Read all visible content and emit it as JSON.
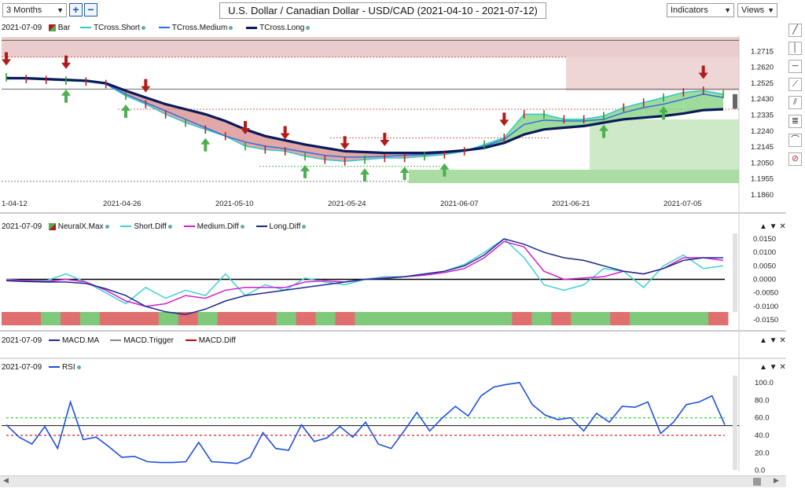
{
  "toolbar": {
    "period": "3 Months",
    "title": "U.S. Dollar / Canadian Dollar - USD/CAD (2021-04-10 - 2021-07-12)",
    "indicators_label": "Indicators",
    "views_label": "Views",
    "zoom_in": "+",
    "zoom_out": "−"
  },
  "colors": {
    "tcross_short": "#2fc8c8",
    "tcross_medium": "#2f6fe0",
    "tcross_long": "#0a1a5a",
    "bull_arrow": "#4caf50",
    "bear_arrow": "#b31b1b",
    "short_diff": "#40d0d0",
    "medium_diff": "#d020d0",
    "long_diff": "#1a2a8a",
    "macd_ma": "#1a2a8a",
    "macd_trigger": "#888888",
    "macd_diff": "#c00000",
    "rsi": "#1e4fe0"
  },
  "panel1_legend": {
    "date": "2021-07-09",
    "bar": "Bar",
    "short": "TCross.Short",
    "medium": "TCross.Medium",
    "long": "TCross.Long"
  },
  "panel2_legend": {
    "date": "2021-07-09",
    "neural": "NeuralX.Max",
    "short": "Short.Diff",
    "medium": "Medium.Diff",
    "long": "Long.Diff"
  },
  "panel3_legend": {
    "date": "2021-07-09",
    "ma": "MACD.MA",
    "trigger": "MACD.Trigger",
    "diff": "MACD.Diff"
  },
  "panel4_legend": {
    "date": "2021-07-09",
    "rsi": "RSI"
  },
  "chart_data": [
    {
      "type": "line",
      "title": "U.S. Dollar / Canadian Dollar - USD/CAD (2021-04-10 - 2021-07-12)",
      "x_ticks": [
        "1-04-12",
        "2021-04-26",
        "2021-05-10",
        "2021-05-24",
        "2021-06-07",
        "2021-06-21",
        "2021-07-05"
      ],
      "y_ticks": [
        "1.2715",
        "1.2620",
        "1.2525",
        "1.2430",
        "1.2335",
        "1.2240",
        "1.2145",
        "1.2050",
        "1.1955",
        "1.1860"
      ],
      "ylim": [
        1.186,
        1.281
      ],
      "series": [
        {
          "name": "TCross.Short",
          "values": [
            1.256,
            1.255,
            1.2545,
            1.254,
            1.2535,
            1.252,
            1.245,
            1.24,
            1.234,
            1.229,
            1.225,
            1.221,
            1.215,
            1.213,
            1.212,
            1.209,
            1.207,
            1.206,
            1.207,
            1.208,
            1.208,
            1.209,
            1.21,
            1.212,
            1.216,
            1.22,
            1.234,
            1.234,
            1.231,
            1.231,
            1.233,
            1.238,
            1.241,
            1.244,
            1.247,
            1.248,
            1.246
          ]
        },
        {
          "name": "TCross.Medium",
          "values": [
            1.256,
            1.2555,
            1.255,
            1.2545,
            1.254,
            1.252,
            1.246,
            1.241,
            1.236,
            1.231,
            1.226,
            1.221,
            1.2175,
            1.215,
            1.2135,
            1.2115,
            1.2095,
            1.2085,
            1.2085,
            1.209,
            1.2095,
            1.21,
            1.211,
            1.2125,
            1.215,
            1.219,
            1.228,
            1.2305,
            1.23,
            1.23,
            1.231,
            1.235,
            1.238,
            1.24,
            1.243,
            1.246,
            1.244
          ]
        },
        {
          "name": "TCross.Long",
          "values": [
            1.2555,
            1.2555,
            1.255,
            1.2545,
            1.254,
            1.2525,
            1.248,
            1.244,
            1.24,
            1.237,
            1.234,
            1.23,
            1.225,
            1.221,
            1.2185,
            1.216,
            1.214,
            1.212,
            1.2115,
            1.211,
            1.211,
            1.211,
            1.2115,
            1.2125,
            1.214,
            1.217,
            1.222,
            1.225,
            1.226,
            1.227,
            1.229,
            1.231,
            1.232,
            1.233,
            1.2345,
            1.2365,
            1.237
          ]
        }
      ],
      "bull_signals_idx": [
        3,
        6,
        10,
        15,
        18,
        20,
        22,
        30,
        33
      ],
      "bear_signals_idx": [
        0,
        3,
        7,
        12,
        14,
        17,
        19,
        25,
        35
      ],
      "grid": false
    },
    {
      "type": "line",
      "y_ticks": [
        "0.0150",
        "0.0100",
        "0.0050",
        "0.0000",
        "-0.0050",
        "-0.0100",
        "-0.0150"
      ],
      "ylim": [
        -0.017,
        0.017
      ],
      "series": [
        {
          "name": "Short.Diff",
          "values": [
            0.0,
            -0.0005,
            -0.0005,
            0.002,
            -0.001,
            -0.005,
            -0.009,
            -0.003,
            -0.007,
            -0.004,
            -0.006,
            0.002,
            -0.006,
            -0.002,
            -0.004,
            0.0005,
            -0.001,
            -0.002,
            0.0,
            0.001,
            0.001,
            0.002,
            0.003,
            0.0055,
            0.01,
            0.015,
            0.008,
            -0.002,
            -0.004,
            -0.002,
            0.004,
            0.003,
            -0.003,
            0.005,
            0.009,
            0.004,
            0.005
          ]
        },
        {
          "name": "Medium.Diff",
          "values": [
            -0.0002,
            -0.0005,
            -0.0008,
            0.0,
            -0.001,
            -0.004,
            -0.008,
            -0.01,
            -0.009,
            -0.006,
            -0.007,
            -0.004,
            -0.003,
            -0.003,
            -0.003,
            -0.001,
            -0.0005,
            -0.001,
            0.0,
            0.0005,
            0.001,
            0.0015,
            0.0025,
            0.004,
            0.008,
            0.014,
            0.012,
            0.003,
            0.0,
            0.0005,
            0.001,
            0.003,
            0.002,
            0.004,
            0.008,
            0.008,
            0.007
          ]
        },
        {
          "name": "Long.Diff",
          "values": [
            -0.0005,
            -0.0008,
            -0.001,
            -0.001,
            -0.0015,
            -0.0035,
            -0.006,
            -0.01,
            -0.012,
            -0.013,
            -0.011,
            -0.008,
            -0.006,
            -0.005,
            -0.004,
            -0.003,
            -0.002,
            -0.001,
            0.0,
            0.0003,
            0.001,
            0.002,
            0.003,
            0.005,
            0.009,
            0.015,
            0.013,
            0.01,
            0.008,
            0.007,
            0.005,
            0.003,
            0.002,
            0.004,
            0.007,
            0.008,
            0.008
          ]
        }
      ],
      "neuralx_bands": [
        "red",
        "red",
        "green",
        "red",
        "green",
        "red",
        "red",
        "red",
        "green",
        "red",
        "green",
        "red",
        "red",
        "red",
        "green",
        "red",
        "green",
        "red",
        "green",
        "green",
        "green",
        "green",
        "green",
        "green",
        "green",
        "green",
        "red",
        "green",
        "red",
        "green",
        "green",
        "red",
        "green",
        "green",
        "green",
        "green",
        "red"
      ]
    },
    {
      "type": "line",
      "series": [
        {
          "name": "MACD.MA",
          "values": []
        },
        {
          "name": "MACD.Trigger",
          "values": []
        },
        {
          "name": "MACD.Diff",
          "values": []
        }
      ]
    },
    {
      "type": "line",
      "y_ticks": [
        "100.0",
        "80.0",
        "60.0",
        "40.0",
        "20.0",
        "0.0"
      ],
      "ylim": [
        -3,
        108
      ],
      "reference_lines": [
        60,
        40
      ],
      "series": [
        {
          "name": "RSI",
          "values": [
            52,
            38,
            30,
            50,
            25,
            78,
            35,
            38,
            27,
            15,
            16,
            10,
            9,
            9,
            10,
            32,
            10,
            9,
            8,
            15,
            43,
            25,
            23,
            52,
            33,
            37,
            50,
            38,
            55,
            30,
            25,
            45,
            66,
            45,
            60,
            73,
            62,
            85,
            95,
            98,
            100,
            75,
            63,
            58,
            60,
            45,
            65,
            55,
            73,
            72,
            78,
            42,
            55,
            75,
            78,
            85,
            52
          ]
        }
      ]
    }
  ]
}
